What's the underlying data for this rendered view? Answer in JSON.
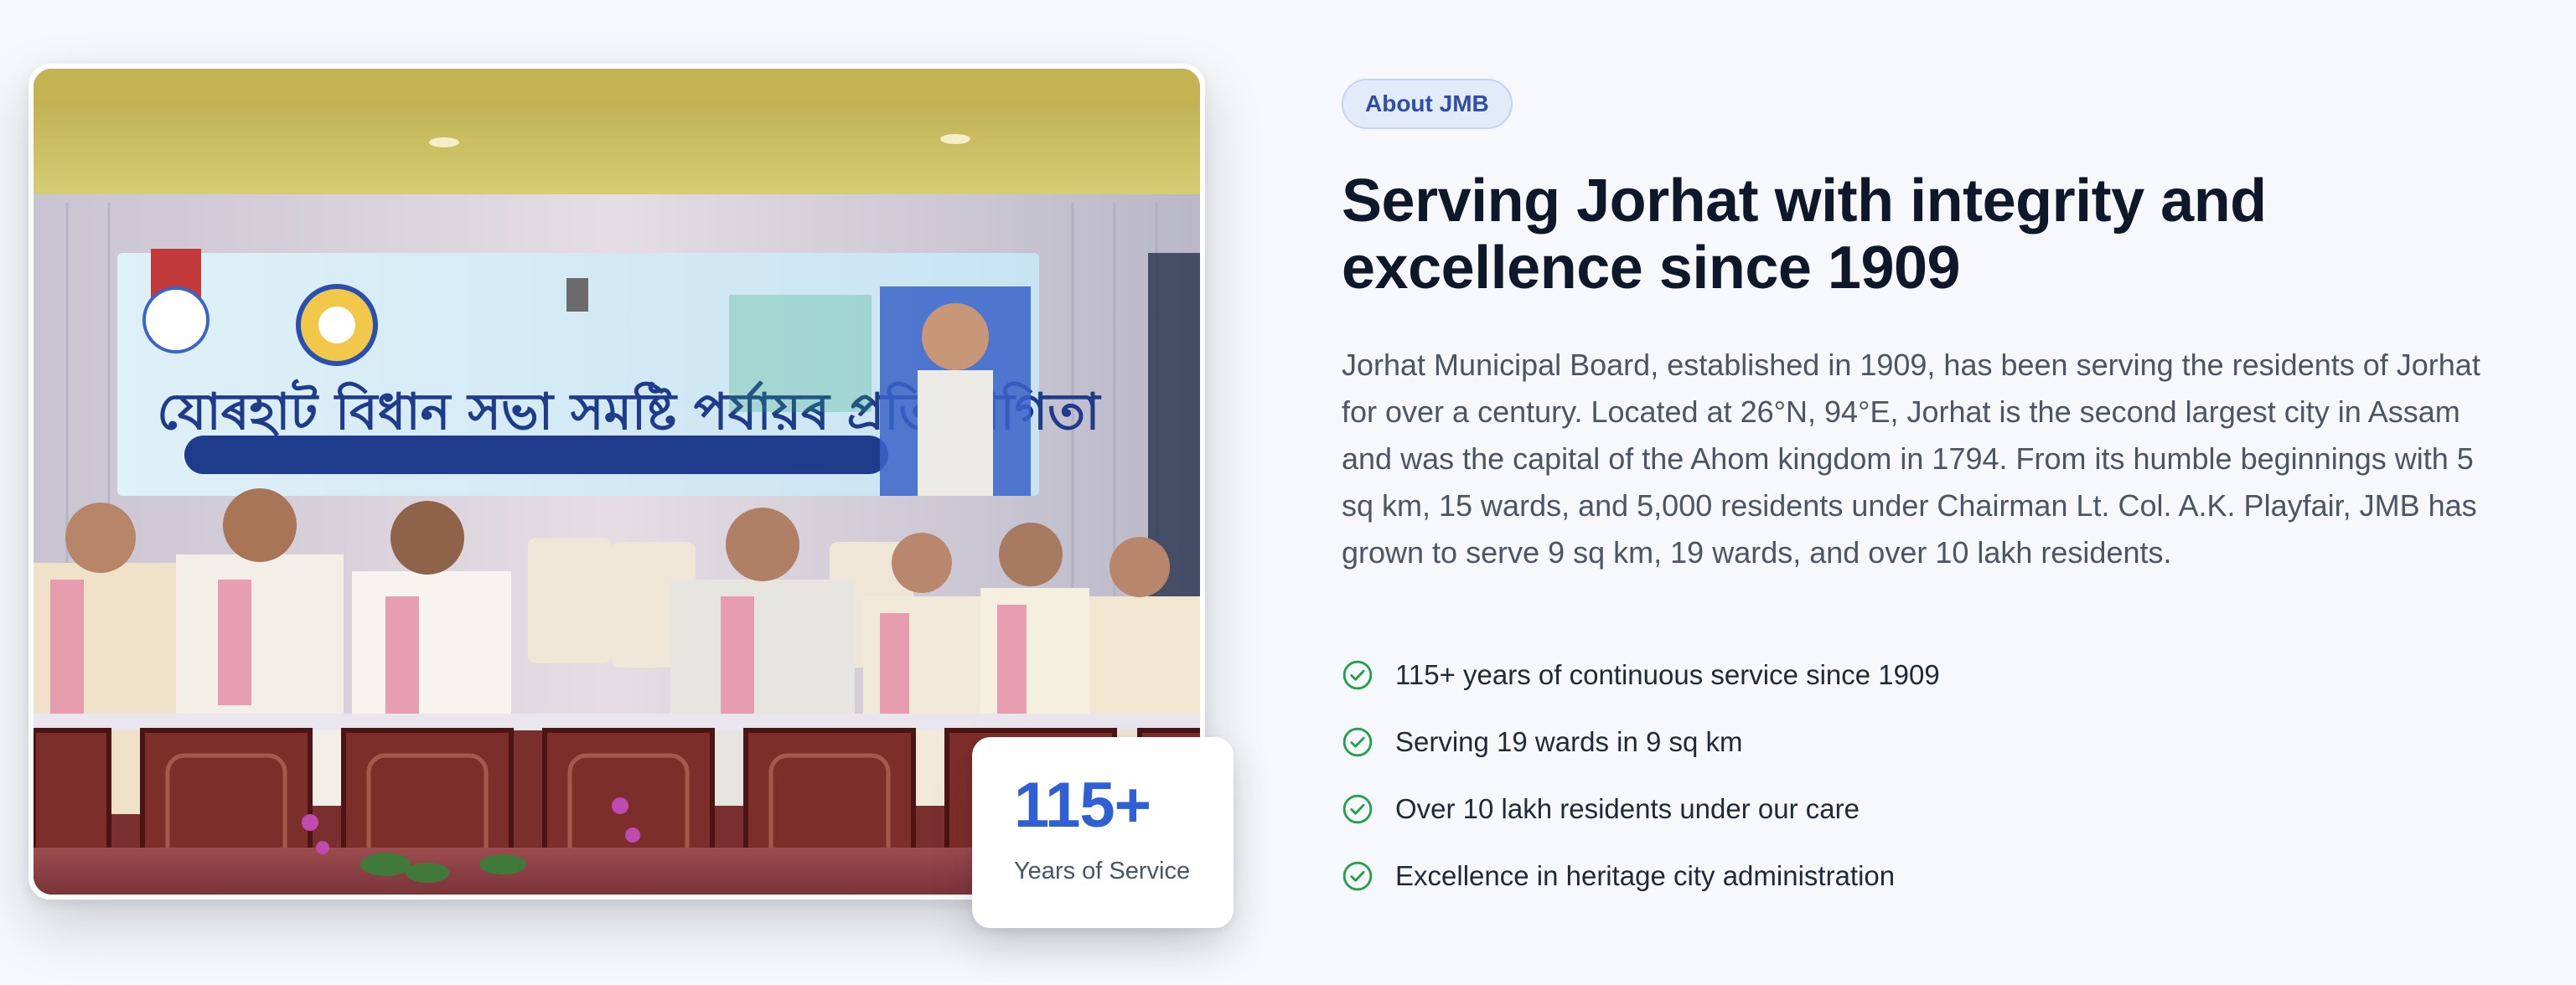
{
  "photo": {
    "alt": "Jorhat Municipal Board event stage with dignitaries seated below a banner",
    "banner_text": "যোৰহাট বিধান সভা সমষ্টি পৰ্যায়ৰ প্ৰতিযোগিতা"
  },
  "stat": {
    "value": "115+",
    "label": "Years of Service"
  },
  "about": {
    "badge": "About JMB",
    "headline": "Serving Jorhat with integrity and excellence since 1909",
    "description": "Jorhat Municipal Board, established in 1909, has been serving the residents of Jorhat for over a century. Located at 26°N, 94°E, Jorhat is the second largest city in Assam and was the capital of the Ahom kingdom in 1794. From its humble beginnings with 5 sq km, 15 wards, and 5,000 residents under Chairman Lt. Col. A.K. Playfair, JMB has grown to serve 9 sq km, 19 wards, and over 10 lakh residents."
  },
  "highlights": [
    {
      "text": "115+ years of continuous service since 1909",
      "icon": "check-circle-icon"
    },
    {
      "text": "Serving 19 wards in 9 sq km",
      "icon": "check-circle-icon"
    },
    {
      "text": "Over 10 lakh residents under our care",
      "icon": "check-circle-icon"
    },
    {
      "text": "Excellence in heritage city administration",
      "icon": "check-circle-icon"
    }
  ],
  "colors": {
    "accent": "#2f5fd4",
    "check": "#22a04b",
    "background": "#f7f8fb"
  }
}
